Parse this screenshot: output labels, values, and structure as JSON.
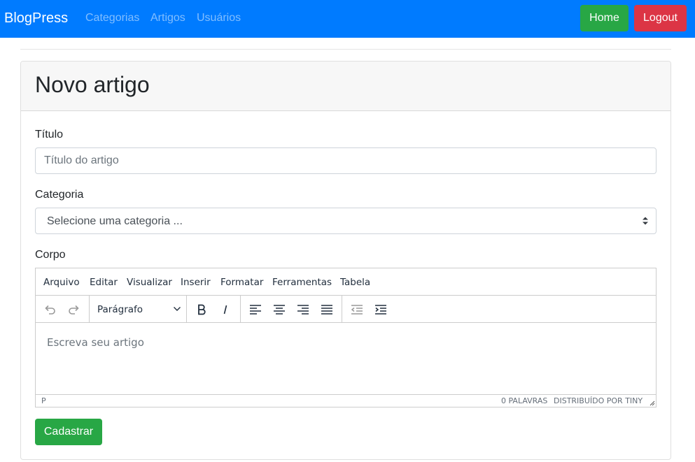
{
  "navbar": {
    "brand": "BlogPress",
    "links": [
      "Categorias",
      "Artigos",
      "Usuários"
    ],
    "home_label": "Home",
    "logout_label": "Logout",
    "color": "#007bff"
  },
  "card": {
    "title": "Novo artigo"
  },
  "form": {
    "title_label": "Título",
    "title_placeholder": "Título do artigo",
    "category_label": "Categoria",
    "category_selected": "Selecione uma categoria ...",
    "body_label": "Corpo",
    "submit_label": "Cadastrar"
  },
  "editor": {
    "menus": [
      "Arquivo",
      "Editar",
      "Visualizar",
      "Inserir",
      "Formatar",
      "Ferramentas",
      "Tabela"
    ],
    "block_format": "Parágrafo",
    "placeholder": "Escreva seu artigo",
    "path": "P",
    "word_count": "0 PALAVRAS",
    "branding": "DISTRIBUÍDO POR TINY",
    "toolbar_icons": [
      "undo-icon",
      "redo-icon",
      "bold-icon",
      "italic-icon",
      "align-left-icon",
      "align-center-icon",
      "align-right-icon",
      "align-justify-icon",
      "outdent-icon",
      "indent-icon"
    ]
  },
  "colors": {
    "success": "#28a745",
    "danger": "#dc3545"
  }
}
